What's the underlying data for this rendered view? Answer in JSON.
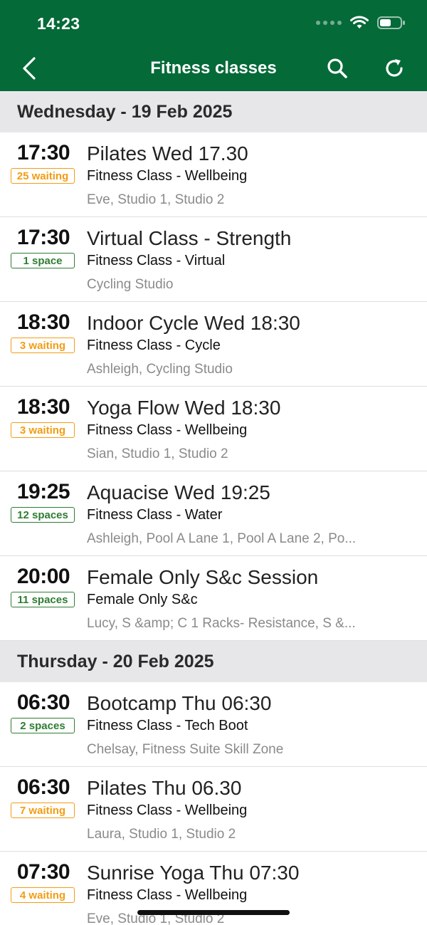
{
  "status_bar": {
    "time": "14:23"
  },
  "nav": {
    "title": "Fitness classes"
  },
  "sections": [
    {
      "header": "Wednesday - 19 Feb 2025",
      "rows": [
        {
          "time": "17:30",
          "badge": "25 waiting",
          "badge_type": "waiting",
          "title": "Pilates Wed 17.30",
          "subtitle": "Fitness Class - Wellbeing",
          "location": "Eve, Studio 1, Studio 2"
        },
        {
          "time": "17:30",
          "badge": "1 space",
          "badge_type": "space",
          "title": "Virtual Class - Strength",
          "subtitle": "Fitness Class - Virtual",
          "location": "Cycling Studio"
        },
        {
          "time": "18:30",
          "badge": "3 waiting",
          "badge_type": "waiting",
          "title": "Indoor Cycle Wed 18:30",
          "subtitle": "Fitness Class - Cycle",
          "location": "Ashleigh, Cycling Studio"
        },
        {
          "time": "18:30",
          "badge": "3 waiting",
          "badge_type": "waiting",
          "title": "Yoga Flow Wed 18:30",
          "subtitle": "Fitness Class - Wellbeing",
          "location": "Sian, Studio 1, Studio 2"
        },
        {
          "time": "19:25",
          "badge": "12 spaces",
          "badge_type": "space",
          "title": "Aquacise Wed 19:25",
          "subtitle": "Fitness Class - Water",
          "location": "Ashleigh, Pool A Lane 1, Pool A Lane 2, Po..."
        },
        {
          "time": "20:00",
          "badge": "11 spaces",
          "badge_type": "space",
          "title": "Female Only S&c Session",
          "subtitle": "Female Only S&c",
          "location": "Lucy, S &amp; C 1 Racks- Resistance, S &..."
        }
      ]
    },
    {
      "header": "Thursday - 20 Feb 2025",
      "rows": [
        {
          "time": "06:30",
          "badge": "2 spaces",
          "badge_type": "space",
          "title": "Bootcamp Thu 06:30",
          "subtitle": "Fitness Class - Tech Boot",
          "location": "Chelsay, Fitness Suite Skill Zone"
        },
        {
          "time": "06:30",
          "badge": "7 waiting",
          "badge_type": "waiting",
          "title": "Pilates Thu 06.30",
          "subtitle": "Fitness Class - Wellbeing",
          "location": "Laura, Studio 1, Studio 2"
        },
        {
          "time": "07:30",
          "badge": "4 waiting",
          "badge_type": "waiting",
          "title": "Sunrise Yoga Thu 07:30",
          "subtitle": "Fitness Class - Wellbeing",
          "location": "Eve, Studio 1, Studio 2"
        }
      ]
    }
  ],
  "colors": {
    "header_bg": "#046a38",
    "waiting": "#f39c12",
    "space": "#2e7d32",
    "section_bg": "#e7e7ea"
  }
}
